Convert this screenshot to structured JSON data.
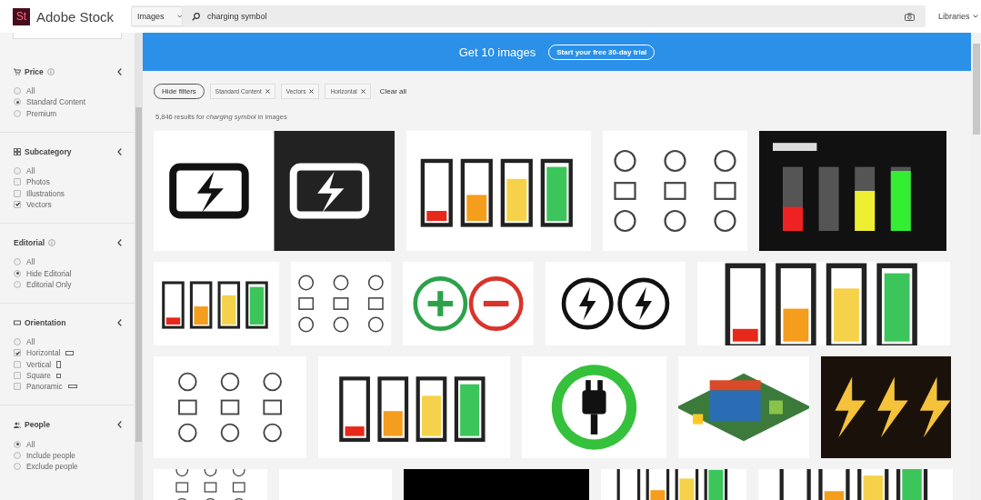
{
  "header": {
    "logo_mark": "St",
    "logo_text": "Adobe Stock",
    "search_type": "Images",
    "search_value": "charging symbol",
    "libraries": "Libraries"
  },
  "sidebar": {
    "sections": [
      {
        "title": "Price",
        "info": true,
        "options": [
          {
            "kind": "radio",
            "label": "All",
            "selected": false
          },
          {
            "kind": "radio",
            "label": "Standard Content",
            "selected": true
          },
          {
            "kind": "radio",
            "label": "Premium",
            "selected": false
          }
        ]
      },
      {
        "title": "Subcategory",
        "info": false,
        "options": [
          {
            "kind": "radio",
            "label": "All",
            "selected": false
          },
          {
            "kind": "checkbox",
            "label": "Photos",
            "checked": false
          },
          {
            "kind": "checkbox",
            "label": "Illustrations",
            "checked": false
          },
          {
            "kind": "checkbox",
            "label": "Vectors",
            "checked": true
          }
        ]
      },
      {
        "title": "Editorial",
        "info": true,
        "options": [
          {
            "kind": "radio",
            "label": "All",
            "selected": false
          },
          {
            "kind": "radio",
            "label": "Hide Editorial",
            "selected": true
          },
          {
            "kind": "radio",
            "label": "Editorial Only",
            "selected": false
          }
        ]
      },
      {
        "title": "Orientation",
        "info": false,
        "options": [
          {
            "kind": "radio",
            "label": "All",
            "selected": false
          },
          {
            "kind": "checkbox",
            "label": "Horizontal",
            "checked": true
          },
          {
            "kind": "checkbox",
            "label": "Vertical",
            "checked": false
          },
          {
            "kind": "checkbox",
            "label": "Square",
            "checked": false
          },
          {
            "kind": "checkbox",
            "label": "Panoramic",
            "checked": false
          }
        ]
      },
      {
        "title": "People",
        "info": false,
        "options": [
          {
            "kind": "radio",
            "label": "All",
            "selected": true
          },
          {
            "kind": "radio",
            "label": "Include people",
            "selected": false
          },
          {
            "kind": "radio",
            "label": "Exclude people",
            "selected": false
          }
        ]
      }
    ]
  },
  "banner": {
    "text": "Get 10 images",
    "button": "Start your free 30-day trial"
  },
  "filters": {
    "hide_button": "Hide filters",
    "chips": [
      "Standard Content",
      "Vectors",
      "Horizontal"
    ],
    "clear": "Clear all"
  },
  "results_summary": "5,846 results for *charging symbol* in images"
}
